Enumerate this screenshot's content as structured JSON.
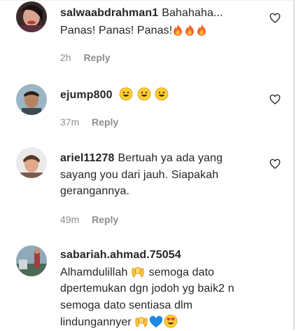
{
  "comments": [
    {
      "username": "salwaabdrahman1",
      "text": "Bahahaha... Panas! Panas! Panas!",
      "emojis": [
        "fire",
        "fire",
        "fire"
      ],
      "time": "2h",
      "reply_label": "Reply"
    },
    {
      "username": "ejump800",
      "text": "",
      "emojis": [
        "grinning-face",
        "grinning-face",
        "grinning-face"
      ],
      "time": "37m",
      "reply_label": "Reply"
    },
    {
      "username": "ariel11278",
      "text": "Bertuah ya ada yang sayang you dari jauh. Siapakah gerangannya.",
      "emojis": [],
      "time": "49m",
      "reply_label": "Reply"
    },
    {
      "username": "sabariah.ahmad.75054",
      "text_part1": "Alhamdulillah",
      "text_part2": "semoga dato dpertemukan dgn jodoh yg baik2 n semoga dato sentiasa dlm lindungannyer",
      "emojis_inline": [
        "open-hands"
      ],
      "emojis_end": [
        "open-hands",
        "blue-heart",
        "heart-eyes-face"
      ]
    }
  ],
  "icons": {
    "like": "heart-outline-icon"
  },
  "colors": {
    "text": "#262626",
    "meta": "#8e8e8e",
    "border": "#dbdbdb"
  }
}
